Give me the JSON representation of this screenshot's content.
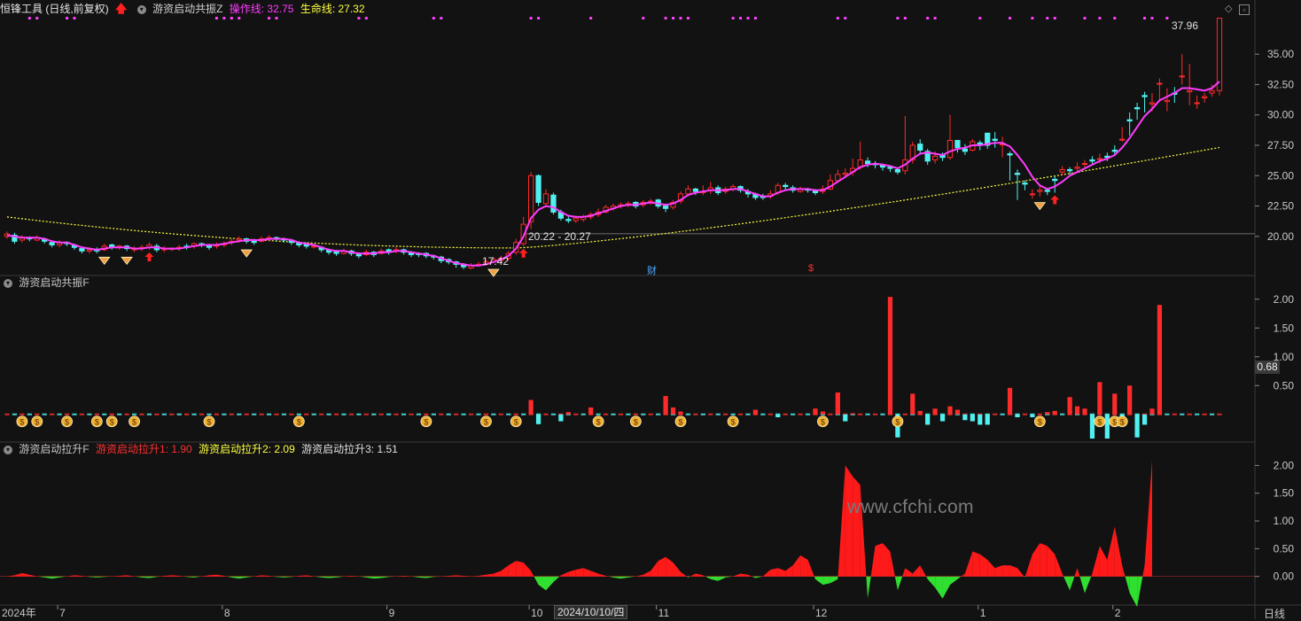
{
  "colors": {
    "up": "#ff2a2a",
    "down": "#50f0f0",
    "operate_line": "#ff3cff",
    "life_line": "#ffff40",
    "money_bag": "#f0b030",
    "signal_dots": "#ff40ff",
    "background": "#121212",
    "grid_text": "#c8c8c8"
  },
  "header_main": {
    "app_title": "恒锋工具 (日线,前复权)",
    "indicator_name": "游资启动共振Z",
    "operate_label": "操作线: 32.75",
    "life_label": "生命线: 27.32"
  },
  "header_mid": {
    "indicator_name": "游资启动共振F"
  },
  "header_bottom": {
    "indicator_name": "游资启动拉升F",
    "line1": "游资启动拉升1: 1.90",
    "line2": "游资启动拉升2: 2.09",
    "line3": "游资启动拉升3: 1.51"
  },
  "annotations": {
    "high_label": "37.96",
    "low_label": "17.42",
    "range_label": "20.22 - 20.27",
    "marker_cai": "财",
    "marker_dollar": "$"
  },
  "watermark": "www.cfchi.com",
  "x_axis": {
    "labels": [
      {
        "text": "2024年",
        "i": 0
      },
      {
        "text": "7",
        "i": 7
      },
      {
        "text": "8",
        "i": 29
      },
      {
        "text": "9",
        "i": 51
      },
      {
        "text": "10",
        "i": 70
      },
      {
        "text": "11",
        "i": 87
      },
      {
        "text": "12",
        "i": 108
      },
      {
        "text": "1",
        "i": 130
      },
      {
        "text": "2",
        "i": 148
      }
    ],
    "cursor_label": "2024/10/10/四",
    "period_label": "日线"
  },
  "current_value_label": "0.68",
  "chart_data": [
    {
      "type": "candlestick",
      "title": "恒锋工具 (日线,前复权)",
      "ylim": [
        17.0,
        38.0
      ],
      "y_ticks": [
        "35.00",
        "32.50",
        "30.00",
        "27.50",
        "25.00",
        "22.50",
        "20.00"
      ],
      "y_tick_values": [
        35.0,
        32.5,
        30.0,
        27.5,
        25.0,
        22.5,
        20.0
      ],
      "close": [
        20.2,
        19.6,
        19.9,
        19.8,
        19.9,
        19.6,
        19.3,
        19.5,
        19.4,
        19.1,
        18.8,
        18.9,
        18.8,
        19.2,
        19.1,
        19.2,
        19.0,
        19.0,
        19.1,
        19.3,
        18.9,
        19.0,
        19.0,
        19.1,
        19.1,
        19.4,
        19.3,
        19.1,
        19.3,
        19.4,
        19.6,
        19.8,
        19.6,
        19.5,
        19.8,
        19.9,
        19.8,
        19.7,
        19.5,
        19.3,
        19.2,
        19.2,
        18.9,
        18.7,
        18.6,
        18.8,
        18.6,
        18.4,
        18.7,
        18.5,
        18.8,
        18.7,
        18.9,
        18.7,
        18.5,
        18.5,
        18.4,
        18.3,
        18.0,
        17.9,
        17.7,
        17.5,
        17.6,
        17.7,
        17.9,
        18.1,
        18.2,
        18.6,
        19.5,
        21.0,
        25.0,
        22.8,
        23.5,
        22.0,
        21.5,
        21.3,
        21.5,
        21.6,
        21.8,
        22.0,
        22.4,
        22.5,
        22.6,
        22.7,
        22.5,
        22.8,
        22.9,
        22.5,
        22.3,
        22.8,
        23.5,
        23.9,
        23.7,
        23.7,
        24.0,
        23.6,
        23.9,
        24.1,
        23.8,
        23.5,
        23.2,
        23.2,
        23.5,
        24.2,
        24.1,
        23.8,
        23.9,
        23.8,
        23.6,
        23.9,
        24.6,
        25.1,
        25.2,
        25.6,
        26.3,
        26.0,
        25.9,
        25.7,
        25.6,
        25.3,
        26.3,
        27.5,
        27.1,
        26.2,
        26.6,
        26.5,
        27.9,
        27.3,
        27.0,
        27.8,
        27.5,
        27.5,
        27.9,
        27.6,
        26.7,
        25.1,
        24.3,
        23.5,
        23.8,
        23.7,
        24.6,
        25.5,
        25.4,
        25.7,
        26.0,
        26.2,
        26.4,
        26.5,
        27.0,
        28.0,
        29.5,
        30.5,
        31.5,
        31.0,
        32.6,
        31.2,
        31.7,
        33.2,
        32.0,
        31.0,
        31.5,
        32.0,
        37.96
      ],
      "open": [
        20.0,
        20.1,
        19.7,
        19.9,
        19.7,
        19.8,
        19.5,
        19.3,
        19.5,
        19.3,
        19.0,
        18.8,
        18.9,
        18.9,
        19.3,
        19.1,
        19.2,
        18.9,
        19.0,
        19.1,
        19.2,
        18.9,
        19.0,
        19.1,
        19.2,
        19.2,
        19.4,
        19.3,
        19.2,
        19.3,
        19.5,
        19.7,
        19.8,
        19.7,
        19.6,
        19.8,
        19.9,
        19.8,
        19.7,
        19.5,
        19.4,
        19.2,
        19.1,
        18.9,
        18.8,
        18.6,
        18.8,
        18.6,
        18.5,
        18.7,
        18.6,
        18.9,
        18.8,
        18.9,
        18.7,
        18.6,
        18.6,
        18.4,
        18.3,
        18.1,
        17.9,
        17.7,
        17.4,
        17.6,
        17.7,
        17.9,
        18.0,
        18.2,
        18.7,
        19.4,
        21.2,
        25.0,
        22.7,
        23.4,
        22.0,
        21.4,
        21.3,
        21.4,
        21.6,
        21.8,
        22.0,
        22.3,
        22.5,
        22.6,
        22.8,
        22.6,
        22.8,
        23.0,
        22.5,
        22.4,
        22.9,
        23.5,
        23.9,
        23.6,
        23.8,
        24.0,
        23.7,
        23.9,
        24.1,
        23.7,
        23.5,
        23.3,
        23.3,
        23.6,
        24.2,
        24.0,
        23.7,
        23.9,
        23.8,
        23.7,
        23.9,
        24.6,
        25.1,
        25.3,
        25.7,
        26.2,
        26.0,
        25.9,
        25.7,
        25.5,
        25.4,
        26.3,
        27.6,
        27.0,
        26.3,
        26.7,
        26.5,
        27.9,
        27.2,
        27.1,
        27.7,
        28.5,
        28.0,
        27.6,
        26.8,
        25.2,
        24.4,
        23.5,
        23.7,
        23.8,
        24.7,
        25.3,
        25.5,
        25.6,
        26.0,
        26.3,
        26.4,
        26.6,
        27.1,
        28.0,
        29.6,
        30.6,
        31.6,
        30.9,
        32.6,
        31.1,
        31.8,
        33.2,
        31.9,
        31.0,
        31.4,
        31.8
      ],
      "high": [
        20.4,
        20.3,
        20.1,
        20.0,
        20.1,
        19.9,
        19.6,
        19.7,
        19.6,
        19.4,
        19.1,
        19.1,
        19.1,
        19.4,
        19.4,
        19.3,
        19.3,
        19.2,
        19.3,
        19.5,
        19.4,
        19.2,
        19.1,
        19.3,
        19.4,
        19.5,
        19.5,
        19.4,
        19.5,
        19.6,
        19.8,
        20.0,
        19.9,
        19.8,
        20.0,
        20.1,
        20.0,
        19.9,
        19.8,
        19.6,
        19.5,
        19.4,
        19.2,
        19.0,
        18.9,
        19.0,
        18.9,
        18.7,
        18.9,
        18.8,
        19.0,
        19.0,
        19.1,
        19.0,
        18.8,
        18.7,
        18.7,
        18.5,
        18.4,
        18.2,
        18.0,
        17.8,
        17.8,
        17.9,
        18.1,
        18.3,
        18.4,
        18.8,
        19.8,
        21.6,
        25.3,
        25.1,
        23.9,
        23.6,
        22.2,
        21.7,
        21.7,
        21.8,
        22.0,
        22.3,
        22.6,
        22.7,
        22.8,
        22.9,
        22.9,
        23.0,
        23.1,
        23.1,
        22.7,
        23.0,
        23.7,
        24.2,
        24.0,
        24.2,
        24.5,
        24.2,
        24.1,
        24.3,
        24.2,
        23.9,
        23.6,
        23.5,
        23.8,
        24.4,
        24.4,
        24.2,
        24.1,
        24.0,
        23.9,
        24.2,
        25.1,
        25.5,
        25.6,
        26.4,
        27.8,
        26.5,
        26.2,
        26.0,
        25.8,
        25.6,
        29.9,
        27.8,
        28.0,
        27.2,
        27.0,
        26.9,
        30.0,
        27.5,
        27.6,
        28.0,
        27.9,
        28.0,
        28.6,
        28.2,
        27.0,
        25.5,
        24.6,
        23.9,
        24.1,
        24.0,
        25.0,
        25.8,
        25.7,
        26.1,
        26.3,
        26.6,
        26.8,
        26.9,
        27.5,
        29.0,
        30.2,
        31.0,
        31.9,
        31.8,
        33.0,
        32.2,
        32.3,
        35.0,
        34.2,
        31.6,
        31.8,
        32.5,
        37.96
      ],
      "low": [
        19.8,
        19.4,
        19.5,
        19.6,
        19.6,
        19.4,
        19.1,
        19.1,
        19.2,
        18.9,
        18.6,
        18.6,
        18.6,
        18.8,
        18.9,
        18.9,
        18.8,
        18.7,
        18.8,
        18.9,
        18.7,
        18.7,
        18.8,
        18.8,
        18.9,
        19.0,
        19.1,
        18.9,
        19.0,
        19.1,
        19.3,
        19.5,
        19.4,
        19.3,
        19.5,
        19.6,
        19.6,
        19.5,
        19.3,
        19.1,
        19.0,
        19.0,
        18.7,
        18.5,
        18.4,
        18.5,
        18.4,
        18.2,
        18.4,
        18.3,
        18.5,
        18.5,
        18.6,
        18.5,
        18.3,
        18.3,
        18.2,
        18.1,
        17.8,
        17.7,
        17.42,
        17.3,
        17.3,
        17.5,
        17.6,
        17.8,
        17.9,
        18.0,
        18.5,
        19.2,
        20.6,
        22.5,
        22.4,
        21.8,
        21.3,
        21.1,
        21.1,
        21.2,
        21.4,
        21.6,
        21.9,
        22.1,
        22.3,
        22.4,
        22.3,
        22.4,
        22.6,
        22.3,
        22.0,
        22.2,
        22.7,
        23.3,
        23.4,
        23.4,
        23.5,
        23.4,
        23.5,
        23.7,
        23.6,
        23.2,
        23.0,
        23.0,
        23.1,
        23.4,
        23.8,
        23.6,
        23.6,
        23.6,
        23.4,
        23.5,
        23.8,
        24.4,
        24.8,
        25.0,
        25.5,
        25.7,
        25.6,
        25.4,
        25.3,
        25.1,
        25.1,
        26.0,
        26.8,
        25.9,
        26.0,
        26.2,
        26.3,
        26.9,
        26.7,
        27.0,
        27.1,
        27.2,
        27.3,
        26.5,
        24.6,
        23.0,
        23.8,
        23.1,
        23.3,
        23.4,
        23.6,
        25.0,
        25.1,
        25.3,
        25.7,
        25.9,
        26.0,
        26.2,
        26.7,
        27.8,
        28.3,
        29.6,
        30.2,
        30.3,
        31.2,
        30.3,
        31.0,
        32.5,
        30.8,
        30.5,
        31.0,
        31.5,
        31.6
      ],
      "operate_line": [
        20.1,
        20.0,
        19.9,
        19.9,
        19.9,
        19.8,
        19.6,
        19.5,
        19.5,
        19.3,
        19.1,
        19.0,
        18.9,
        19.0,
        19.1,
        19.1,
        19.1,
        19.0,
        19.0,
        19.1,
        19.1,
        19.0,
        19.0,
        19.0,
        19.1,
        19.2,
        19.3,
        19.3,
        19.3,
        19.4,
        19.5,
        19.6,
        19.7,
        19.7,
        19.7,
        19.8,
        19.8,
        19.8,
        19.7,
        19.5,
        19.4,
        19.3,
        19.1,
        18.9,
        18.8,
        18.8,
        18.7,
        18.6,
        18.6,
        18.6,
        18.7,
        18.7,
        18.8,
        18.8,
        18.7,
        18.6,
        18.5,
        18.4,
        18.2,
        18.0,
        17.8,
        17.7,
        17.6,
        17.6,
        17.7,
        17.9,
        18.1,
        18.4,
        19.0,
        20.0,
        21.5,
        22.2,
        22.5,
        22.4,
        22.0,
        21.7,
        21.6,
        21.6,
        21.7,
        21.9,
        22.1,
        22.3,
        22.5,
        22.6,
        22.6,
        22.7,
        22.8,
        22.7,
        22.6,
        22.7,
        23.0,
        23.4,
        23.6,
        23.7,
        23.8,
        23.8,
        23.8,
        23.9,
        23.9,
        23.7,
        23.5,
        23.3,
        23.3,
        23.6,
        23.8,
        23.9,
        23.9,
        23.9,
        23.8,
        23.8,
        24.1,
        24.5,
        24.9,
        25.3,
        25.7,
        25.9,
        26.0,
        25.9,
        25.8,
        25.6,
        25.9,
        26.4,
        26.8,
        26.9,
        26.8,
        26.7,
        27.0,
        27.2,
        27.3,
        27.5,
        27.5,
        27.6,
        27.7,
        27.7,
        27.4,
        26.7,
        25.9,
        24.9,
        24.2,
        23.9,
        24.1,
        24.5,
        25.0,
        25.3,
        25.6,
        25.9,
        26.2,
        26.4,
        26.7,
        27.3,
        28.1,
        29.0,
        29.9,
        30.5,
        31.2,
        31.5,
        31.8,
        32.2,
        32.2,
        32.1,
        32.0,
        32.2,
        32.75
      ],
      "life_line_start": 21.6,
      "life_line_min": 19.05,
      "life_line_end": 27.32
    },
    {
      "type": "bar",
      "title": "游资启动共振F",
      "ylim": [
        -0.45,
        2.15
      ],
      "y_ticks": [
        "2.00",
        "1.50",
        "1.00",
        "0.50"
      ],
      "y_tick_values": [
        2.0,
        1.5,
        1.0,
        0.5
      ],
      "values": {
        "70": 0.25,
        "71": -0.17,
        "74": -0.12,
        "75": 0.04,
        "78": 0.12,
        "88": 0.32,
        "89": 0.12,
        "90": 0.05,
        "100": 0.08,
        "103": -0.05,
        "108": 0.1,
        "109": 0.05,
        "111": 0.38,
        "112": -0.12,
        "113": 0.02,
        "118": 2.04,
        "119": -0.4,
        "121": 0.36,
        "122": 0.06,
        "123": -0.18,
        "124": 0.1,
        "125": -0.12,
        "126": 0.14,
        "127": 0.08,
        "128": -0.1,
        "129": -0.12,
        "130": -0.18,
        "131": -0.18,
        "134": 0.46,
        "135": -0.05,
        "137": -0.05,
        "139": 0.04,
        "140": 0.06,
        "142": 0.3,
        "143": 0.14,
        "144": 0.1,
        "145": -0.42,
        "146": 0.56,
        "147": -0.42,
        "148": 0.36,
        "149": -0.2,
        "150": 0.5,
        "151": -0.4,
        "152": -0.18,
        "153": 0.1,
        "154": 1.9
      },
      "bags": [
        2,
        4,
        8,
        12,
        14,
        17,
        27,
        39,
        56,
        64,
        68,
        79,
        84,
        90,
        97,
        109,
        119,
        138,
        146,
        148,
        149
      ]
    },
    {
      "type": "area",
      "title": "游资启动拉升F",
      "ylim": [
        -0.5,
        2.15
      ],
      "y_ticks": [
        "2.00",
        "1.50",
        "1.00",
        "0.50",
        "0.00"
      ],
      "y_tick_values": [
        2.0,
        1.5,
        1.0,
        0.5,
        0.0
      ],
      "values": [
        0.0,
        0.02,
        0.06,
        0.03,
        0.0,
        -0.02,
        -0.04,
        -0.02,
        0.0,
        0.02,
        0.01,
        -0.01,
        -0.02,
        -0.01,
        0.0,
        0.01,
        0.02,
        0.0,
        -0.02,
        -0.03,
        -0.01,
        0.01,
        0.02,
        0.01,
        -0.01,
        -0.02,
        0.0,
        0.02,
        0.03,
        0.01,
        -0.02,
        -0.04,
        -0.02,
        0.0,
        0.02,
        0.01,
        -0.01,
        -0.02,
        -0.01,
        0.01,
        0.02,
        0.0,
        -0.02,
        -0.03,
        -0.02,
        0.0,
        0.01,
        0.0,
        -0.02,
        -0.04,
        -0.03,
        -0.01,
        0.0,
        0.01,
        0.0,
        -0.02,
        -0.03,
        -0.01,
        0.0,
        0.01,
        0.02,
        0.01,
        0.0,
        0.01,
        0.03,
        0.05,
        0.1,
        0.2,
        0.28,
        0.25,
        0.1,
        -0.15,
        -0.25,
        -0.1,
        0.02,
        0.08,
        0.12,
        0.15,
        0.1,
        0.05,
        0.01,
        -0.02,
        -0.04,
        -0.02,
        0.0,
        0.03,
        0.1,
        0.28,
        0.35,
        0.25,
        0.08,
        -0.02,
        0.05,
        0.02,
        -0.05,
        -0.08,
        -0.02,
        0.0,
        0.05,
        0.03,
        -0.03,
        0.0,
        0.12,
        0.15,
        0.1,
        0.2,
        0.38,
        0.3,
        -0.05,
        -0.15,
        -0.12,
        -0.05,
        2.0,
        1.8,
        1.65,
        -0.4,
        0.55,
        0.6,
        0.45,
        -0.25,
        0.15,
        0.05,
        0.2,
        -0.05,
        -0.2,
        -0.4,
        -0.15,
        -0.05,
        0.05,
        0.45,
        0.4,
        0.3,
        0.15,
        0.2,
        0.2,
        0.15,
        -0.02,
        0.4,
        0.6,
        0.55,
        0.4,
        0.05,
        -0.25,
        0.15,
        -0.3,
        0.05,
        0.55,
        0.3,
        0.9,
        0.2,
        -0.3,
        -0.55,
        0.2,
        2.09
      ]
    }
  ]
}
